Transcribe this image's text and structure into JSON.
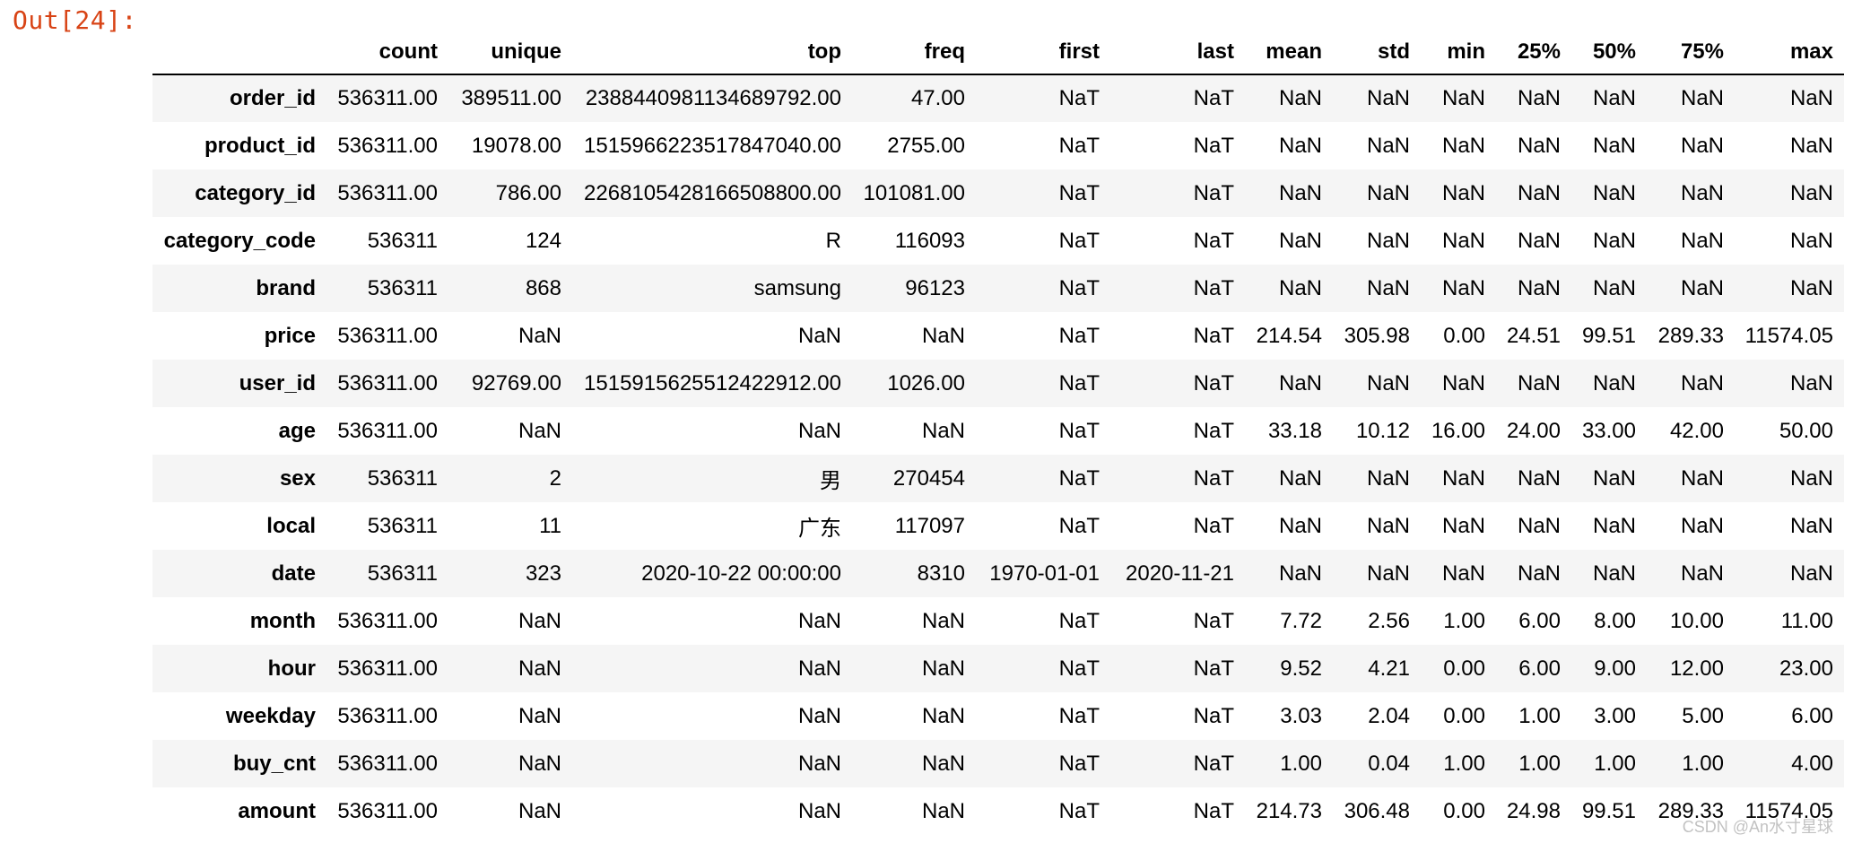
{
  "prompt": "Out[24]:",
  "watermark": "CSDN @An水寸星球",
  "columns": [
    "",
    "count",
    "unique",
    "top",
    "freq",
    "first",
    "last",
    "mean",
    "std",
    "min",
    "25%",
    "50%",
    "75%",
    "max"
  ],
  "rows": [
    [
      "order_id",
      "536311.00",
      "389511.00",
      "2388440981134689792.00",
      "47.00",
      "NaT",
      "NaT",
      "NaN",
      "NaN",
      "NaN",
      "NaN",
      "NaN",
      "NaN",
      "NaN"
    ],
    [
      "product_id",
      "536311.00",
      "19078.00",
      "1515966223517847040.00",
      "2755.00",
      "NaT",
      "NaT",
      "NaN",
      "NaN",
      "NaN",
      "NaN",
      "NaN",
      "NaN",
      "NaN"
    ],
    [
      "category_id",
      "536311.00",
      "786.00",
      "2268105428166508800.00",
      "101081.00",
      "NaT",
      "NaT",
      "NaN",
      "NaN",
      "NaN",
      "NaN",
      "NaN",
      "NaN",
      "NaN"
    ],
    [
      "category_code",
      "536311",
      "124",
      "R",
      "116093",
      "NaT",
      "NaT",
      "NaN",
      "NaN",
      "NaN",
      "NaN",
      "NaN",
      "NaN",
      "NaN"
    ],
    [
      "brand",
      "536311",
      "868",
      "samsung",
      "96123",
      "NaT",
      "NaT",
      "NaN",
      "NaN",
      "NaN",
      "NaN",
      "NaN",
      "NaN",
      "NaN"
    ],
    [
      "price",
      "536311.00",
      "NaN",
      "NaN",
      "NaN",
      "NaT",
      "NaT",
      "214.54",
      "305.98",
      "0.00",
      "24.51",
      "99.51",
      "289.33",
      "11574.05"
    ],
    [
      "user_id",
      "536311.00",
      "92769.00",
      "1515915625512422912.00",
      "1026.00",
      "NaT",
      "NaT",
      "NaN",
      "NaN",
      "NaN",
      "NaN",
      "NaN",
      "NaN",
      "NaN"
    ],
    [
      "age",
      "536311.00",
      "NaN",
      "NaN",
      "NaN",
      "NaT",
      "NaT",
      "33.18",
      "10.12",
      "16.00",
      "24.00",
      "33.00",
      "42.00",
      "50.00"
    ],
    [
      "sex",
      "536311",
      "2",
      "男",
      "270454",
      "NaT",
      "NaT",
      "NaN",
      "NaN",
      "NaN",
      "NaN",
      "NaN",
      "NaN",
      "NaN"
    ],
    [
      "local",
      "536311",
      "11",
      "广东",
      "117097",
      "NaT",
      "NaT",
      "NaN",
      "NaN",
      "NaN",
      "NaN",
      "NaN",
      "NaN",
      "NaN"
    ],
    [
      "date",
      "536311",
      "323",
      "2020-10-22 00:00:00",
      "8310",
      "1970-01-01",
      "2020-11-21",
      "NaN",
      "NaN",
      "NaN",
      "NaN",
      "NaN",
      "NaN",
      "NaN"
    ],
    [
      "month",
      "536311.00",
      "NaN",
      "NaN",
      "NaN",
      "NaT",
      "NaT",
      "7.72",
      "2.56",
      "1.00",
      "6.00",
      "8.00",
      "10.00",
      "11.00"
    ],
    [
      "hour",
      "536311.00",
      "NaN",
      "NaN",
      "NaN",
      "NaT",
      "NaT",
      "9.52",
      "4.21",
      "0.00",
      "6.00",
      "9.00",
      "12.00",
      "23.00"
    ],
    [
      "weekday",
      "536311.00",
      "NaN",
      "NaN",
      "NaN",
      "NaT",
      "NaT",
      "3.03",
      "2.04",
      "0.00",
      "1.00",
      "3.00",
      "5.00",
      "6.00"
    ],
    [
      "buy_cnt",
      "536311.00",
      "NaN",
      "NaN",
      "NaN",
      "NaT",
      "NaT",
      "1.00",
      "0.04",
      "1.00",
      "1.00",
      "1.00",
      "1.00",
      "4.00"
    ],
    [
      "amount",
      "536311.00",
      "NaN",
      "NaN",
      "NaN",
      "NaT",
      "NaT",
      "214.73",
      "306.48",
      "0.00",
      "24.98",
      "99.51",
      "289.33",
      "11574.05"
    ]
  ]
}
